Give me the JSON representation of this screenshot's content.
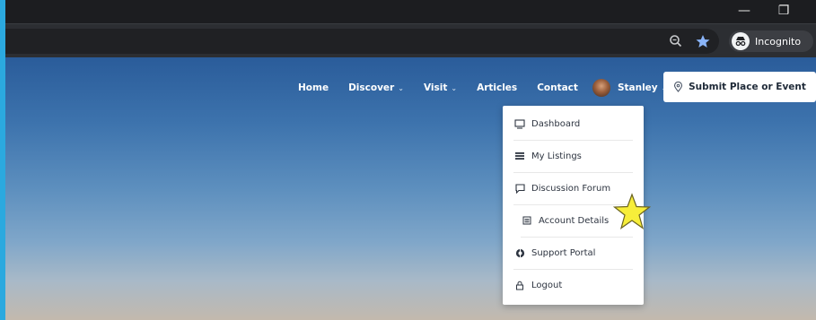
{
  "window_controls": {
    "minimize": "—",
    "restore": "❐"
  },
  "toolbar": {
    "icons": [
      "zoom-icon",
      "bookmark-star-icon"
    ],
    "profile_label": "Incognito"
  },
  "site_nav": {
    "items": [
      {
        "label": "Home",
        "has_dropdown": false
      },
      {
        "label": "Discover",
        "has_dropdown": true
      },
      {
        "label": "Visit",
        "has_dropdown": true
      },
      {
        "label": "Articles",
        "has_dropdown": false
      },
      {
        "label": "Contact",
        "has_dropdown": false
      }
    ],
    "user_name": "Stanley",
    "submit_label": "Submit Place or Event"
  },
  "user_menu": {
    "items": [
      {
        "label": "Dashboard",
        "icon": "monitor-icon"
      },
      {
        "label": "My Listings",
        "icon": "list-icon"
      },
      {
        "label": "Discussion Forum",
        "icon": "chat-icon"
      },
      {
        "label": "Account Details",
        "icon": "id-card-icon"
      },
      {
        "label": "Support Portal",
        "icon": "lifebuoy-icon"
      },
      {
        "label": "Logout",
        "icon": "lock-icon"
      }
    ]
  },
  "annotation": {
    "icon": "highlight-star-icon",
    "color": "#f7ee3a"
  }
}
